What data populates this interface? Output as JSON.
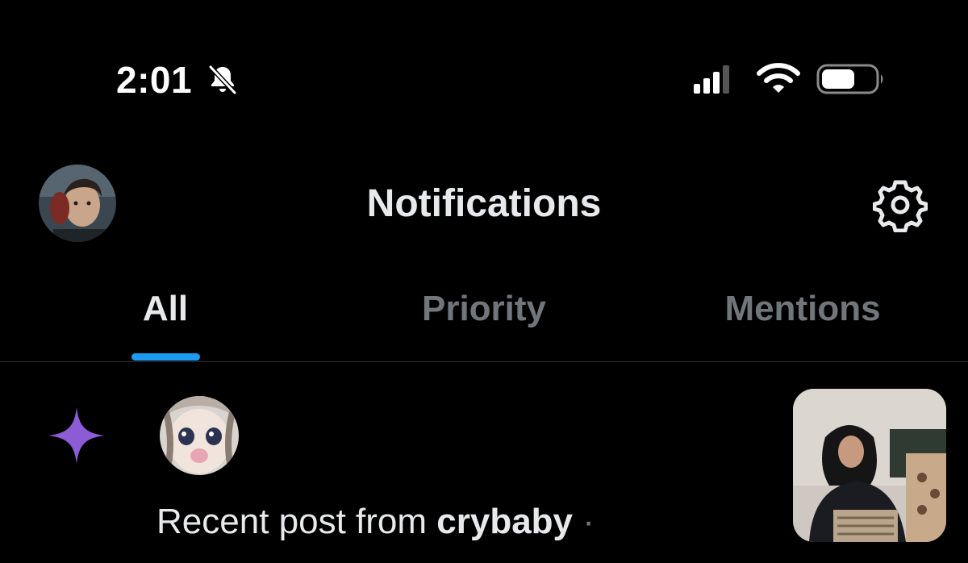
{
  "status_bar": {
    "time": "2:01",
    "icons": [
      "bell-muted-icon",
      "cellular-signal-icon",
      "wifi-icon",
      "battery-icon"
    ]
  },
  "header": {
    "title": "Notifications",
    "avatar_icon": "profile-avatar",
    "settings_icon": "gear-icon"
  },
  "tabs": [
    {
      "label": "All",
      "active": true
    },
    {
      "label": "Priority",
      "active": false
    },
    {
      "label": "Mentions",
      "active": false
    }
  ],
  "notification": {
    "icon": "sparkle-icon",
    "text_prefix": "Recent post from ",
    "username": "crybaby",
    "separator": " ·"
  },
  "colors": {
    "background": "#000000",
    "text_primary": "#e7e9ea",
    "text_secondary": "#71767b",
    "accent": "#1d9bf0",
    "sparkle": "#8b5cd6"
  }
}
